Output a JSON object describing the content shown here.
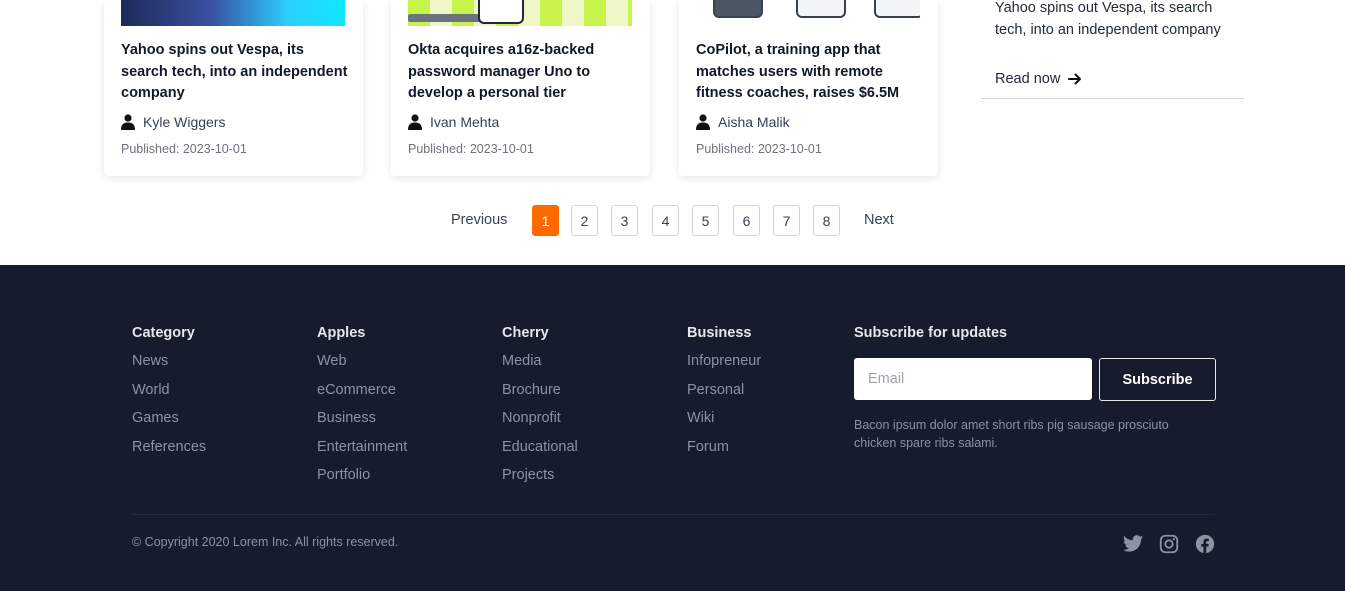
{
  "articles": [
    {
      "title": "Yahoo spins out Vespa, its search tech, into an independent company",
      "author": "Kyle Wiggers",
      "published": "Published: 2023-10-01"
    },
    {
      "title": "Okta acquires a16z-backed password manager Uno to develop a personal tier",
      "author": "Ivan Mehta",
      "published": "Published: 2023-10-01"
    },
    {
      "title": "CoPilot, a training app that matches users with remote fitness coaches, raises $6.5M",
      "author": "Aisha Malik",
      "published": "Published: 2023-10-01"
    }
  ],
  "sidebar": {
    "item_title": "Yahoo spins out Vespa, its search tech, into an independent company",
    "read_now": "Read now"
  },
  "pagination": {
    "previous": "Previous",
    "next": "Next",
    "pages": [
      "1",
      "2",
      "3",
      "4",
      "5",
      "6",
      "7",
      "8"
    ],
    "active_page": "1"
  },
  "footer": {
    "columns": [
      {
        "heading": "Category",
        "links": [
          "News",
          "World",
          "Games",
          "References"
        ]
      },
      {
        "heading": "Apples",
        "links": [
          "Web",
          "eCommerce",
          "Business",
          "Entertainment",
          "Portfolio"
        ]
      },
      {
        "heading": "Cherry",
        "links": [
          "Media",
          "Brochure",
          "Nonprofit",
          "Educational",
          "Projects"
        ]
      },
      {
        "heading": "Business",
        "links": [
          "Infopreneur",
          "Personal",
          "Wiki",
          "Forum"
        ]
      }
    ],
    "subscribe": {
      "heading": "Subscribe for updates",
      "email_placeholder": "Email",
      "button": "Subscribe",
      "description": "Bacon ipsum dolor amet short ribs pig sausage prosciuto chicken spare ribs salami."
    },
    "copyright": "© Copyright 2020 Lorem Inc. All rights reserved.",
    "social_icons": [
      "twitter-icon",
      "instagram-icon",
      "facebook-icon"
    ]
  },
  "colors": {
    "accent": "#ff6a00",
    "footer_bg": "#161b2e",
    "footer_text": "#8b93a3"
  }
}
